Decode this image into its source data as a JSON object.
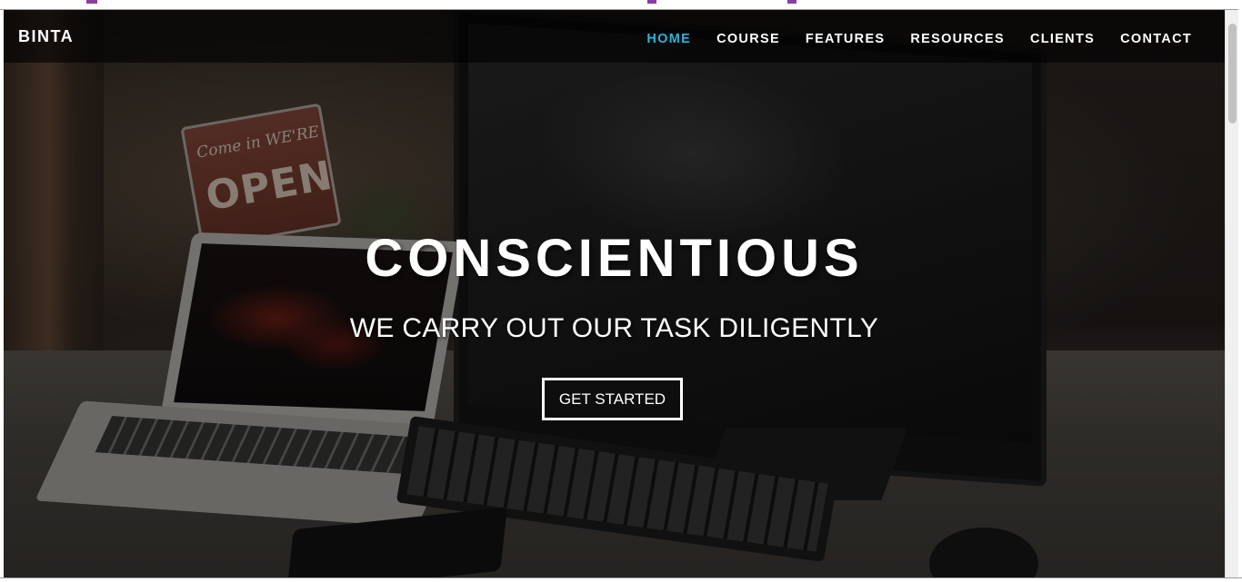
{
  "brand": {
    "name": "BINTA"
  },
  "nav": {
    "items": [
      {
        "label": "HOME",
        "active": true
      },
      {
        "label": "COURSE",
        "active": false
      },
      {
        "label": "FEATURES",
        "active": false
      },
      {
        "label": "RESOURCES",
        "active": false
      },
      {
        "label": "CLIENTS",
        "active": false
      },
      {
        "label": "CONTACT",
        "active": false
      }
    ],
    "active_color": "#2fb3d9"
  },
  "hero": {
    "title": "CONSCIENTIOUS",
    "subtitle": "WE CARRY OUT OUR TASK DILIGENTLY",
    "cta_label": "GET STARTED"
  },
  "background": {
    "sign_line1": "Come in WE'RE",
    "sign_line2": "OPEN"
  }
}
